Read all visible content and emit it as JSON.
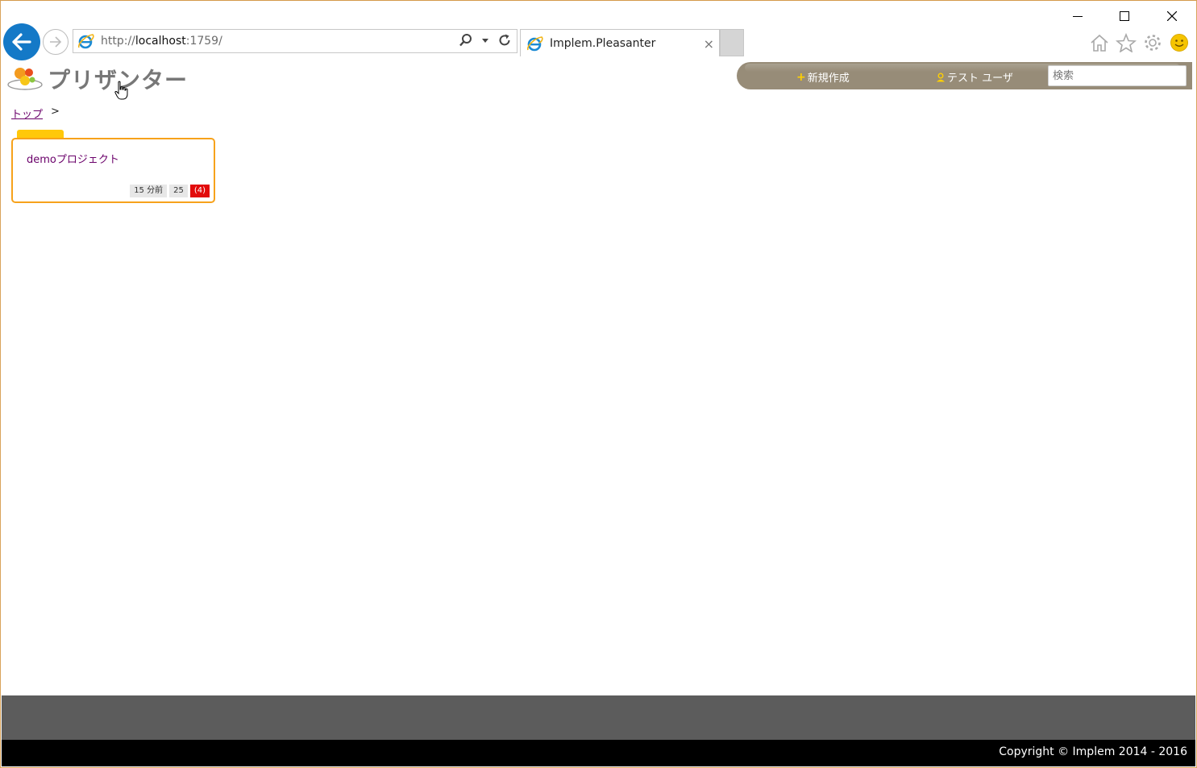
{
  "browser": {
    "url_prefix": "http://",
    "url_host": "localhost",
    "url_suffix": ":1759/",
    "tab_title": "Implem.Pleasanter",
    "tab_close": "×",
    "icons": [
      "back-icon",
      "forward-icon",
      "ie-icon",
      "search-icon",
      "dropdown-icon",
      "refresh-icon",
      "home-icon",
      "favorites-star-icon",
      "settings-gear-icon",
      "smiley-feedback-icon"
    ]
  },
  "window": {
    "controls": [
      "minimize",
      "maximize",
      "close"
    ]
  },
  "header": {
    "logo_text": "プリザンター",
    "new_label": "新規作成",
    "user_label": "テスト ユーザ",
    "search_placeholder": "検索"
  },
  "breadcrumb": {
    "top": "トップ",
    "separator": ">"
  },
  "folder": {
    "name": "demoプロジェクト",
    "updated": "15 分前",
    "count": "25",
    "overdue": "(4)"
  },
  "footer": {
    "copyright": "Copyright © Implem 2014 - 2016"
  },
  "colors": {
    "nav_bar": "#978c78",
    "folder_border": "#f7a21b",
    "folder_tab": "#ffc80a",
    "link": "#6a006a",
    "badge_alert": "#e20a0a",
    "footer_top": "#5c5c5c",
    "footer_bottom": "#000000",
    "ie_blue": "#1479c7"
  }
}
